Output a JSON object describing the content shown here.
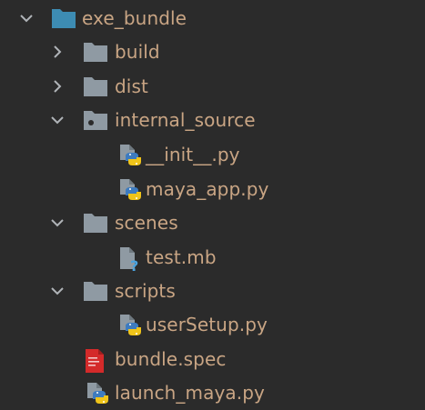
{
  "tree": {
    "root": {
      "label": "exe_bundle",
      "icon": "folder-icon"
    },
    "items": [
      {
        "label": "build",
        "icon": "folder-icon"
      },
      {
        "label": "dist",
        "icon": "folder-icon"
      },
      {
        "label": "internal_source",
        "icon": "package-folder-icon"
      },
      {
        "label": "__init__.py",
        "icon": "python-file-icon"
      },
      {
        "label": "maya_app.py",
        "icon": "python-file-icon"
      },
      {
        "label": "scenes",
        "icon": "folder-icon"
      },
      {
        "label": "test.mb",
        "icon": "unknown-file-icon"
      },
      {
        "label": "scripts",
        "icon": "folder-icon"
      },
      {
        "label": "userSetup.py",
        "icon": "python-file-icon"
      },
      {
        "label": "bundle.spec",
        "icon": "spec-file-icon"
      },
      {
        "label": "launch_maya.py",
        "icon": "python-file-icon"
      }
    ]
  },
  "colors": {
    "background": "#2b2b2b",
    "label": "#c9a584",
    "folder": "#8f9aa3",
    "root_folder": "#3d8cb3",
    "chevron": "#b0b4b8"
  }
}
